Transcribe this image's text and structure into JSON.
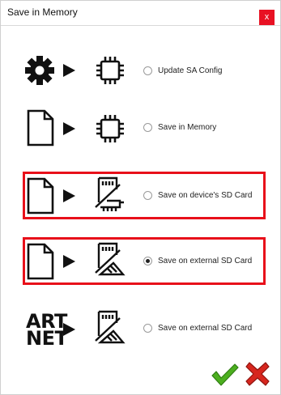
{
  "window": {
    "title": "Save in Memory",
    "close_symbol": "x"
  },
  "options": [
    {
      "label": "Update SA Config",
      "source_icon": "gear-icon",
      "target_icon": "chip-icon",
      "selected": false,
      "highlighted": false
    },
    {
      "label": "Save in Memory",
      "source_icon": "file-icon",
      "target_icon": "chip-icon",
      "selected": false,
      "highlighted": false
    },
    {
      "label": "Save on device's SD Card",
      "source_icon": "file-icon",
      "target_icon": "sd-card-icon",
      "selected": false,
      "highlighted": true
    },
    {
      "label": "Save on external SD Card",
      "source_icon": "file-icon",
      "target_icon": "sd-card-icon",
      "selected": true,
      "highlighted": true
    },
    {
      "label": "Save on external SD Card",
      "source_icon": "artnet-logo",
      "target_icon": "sd-card-icon",
      "selected": false,
      "highlighted": false
    }
  ],
  "artnet_logo": {
    "line1": "ART",
    "line2": "NET"
  },
  "footer": {
    "ok_icon": "checkmark-icon",
    "cancel_icon": "red-x-icon"
  },
  "colors": {
    "highlight": "#e8101a",
    "ok": "#4caf1f",
    "cancel": "#d7261e"
  }
}
